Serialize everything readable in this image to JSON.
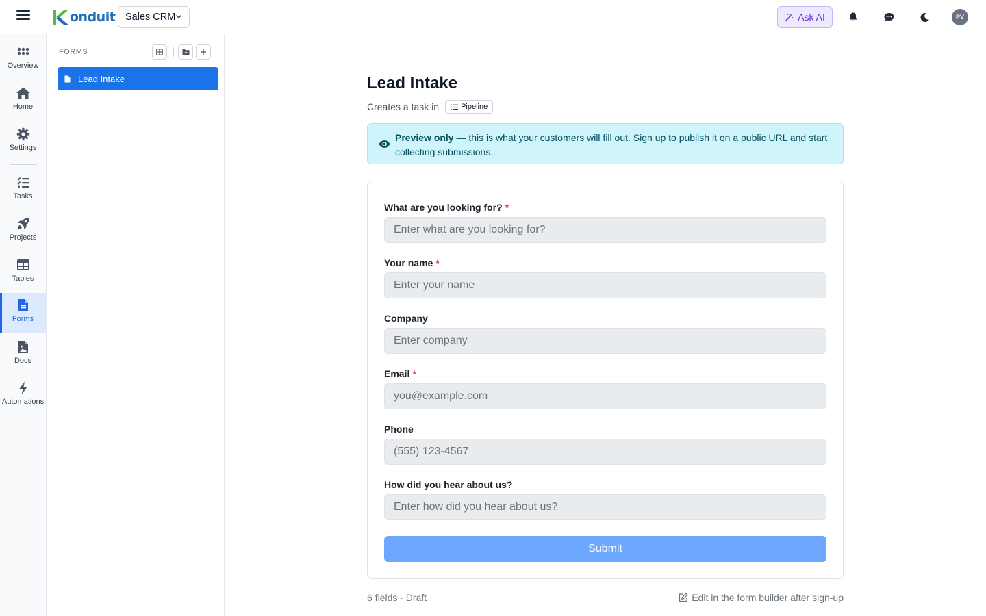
{
  "app": {
    "logo_text": "onduit",
    "workspace": "Sales CRM",
    "ask_ai": "Ask AI",
    "avatar_initials": "PV",
    "brand_color": "#1d6fb8",
    "accent_color": "#1a73e8"
  },
  "topbar_icons": [
    "menu-icon",
    "bell-icon",
    "chat-icon",
    "moon-icon"
  ],
  "nav": {
    "items": [
      {
        "label": "Overview",
        "icon": "grid-dots-icon"
      },
      {
        "label": "Home",
        "icon": "home-icon"
      },
      {
        "label": "Settings",
        "icon": "gear-icon"
      },
      {
        "label": "Tasks",
        "icon": "task-list-icon"
      },
      {
        "label": "Projects",
        "icon": "rocket-icon"
      },
      {
        "label": "Tables",
        "icon": "table-icon"
      },
      {
        "label": "Forms",
        "icon": "form-doc-icon",
        "active": true
      },
      {
        "label": "Docs",
        "icon": "doc-image-icon"
      },
      {
        "label": "Automations",
        "icon": "lightning-icon"
      }
    ]
  },
  "forms_panel": {
    "title": "FORMS",
    "items": [
      {
        "label": "Lead Intake",
        "selected": true
      }
    ]
  },
  "form": {
    "title": "Lead Intake",
    "subtitle_prefix": "Creates a task in",
    "target": "Pipeline",
    "banner_bold": "Preview only",
    "banner_text": " — this is what your customers will fill out. Sign up to publish it on a public URL and start collecting submissions.",
    "fields": [
      {
        "label": "What are you looking for?",
        "required": true,
        "placeholder": "Enter what are you looking for?"
      },
      {
        "label": "Your name",
        "required": true,
        "placeholder": "Enter your name"
      },
      {
        "label": "Company",
        "required": false,
        "placeholder": "Enter company"
      },
      {
        "label": "Email",
        "required": true,
        "placeholder": "you@example.com"
      },
      {
        "label": "Phone",
        "required": false,
        "placeholder": "(555) 123-4567"
      },
      {
        "label": "How did you hear about us?",
        "required": false,
        "placeholder": "Enter how did you hear about us?"
      }
    ],
    "required_marker": "*",
    "submit_label": "Submit",
    "footer_status": "6 fields · Draft",
    "footer_hint": "Edit in the form builder after sign-up"
  }
}
